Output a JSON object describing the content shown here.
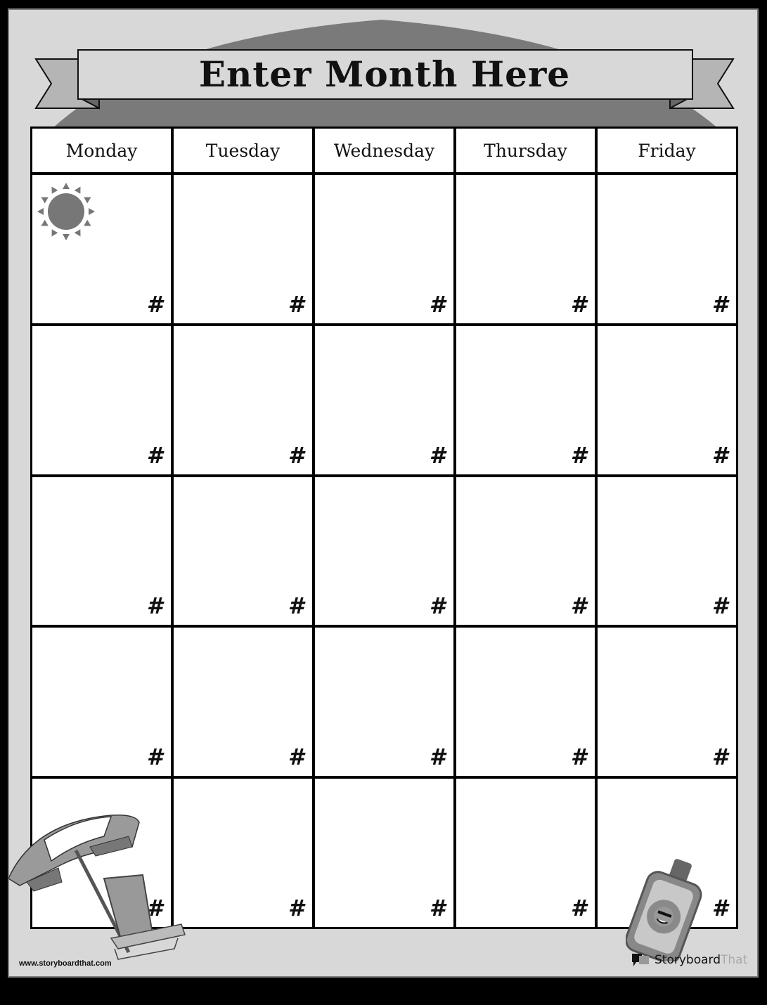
{
  "title": "Enter Month Here",
  "days": [
    "Monday",
    "Tuesday",
    "Wednesday",
    "Thursday",
    "Friday"
  ],
  "weeks": [
    [
      "#",
      "#",
      "#",
      "#",
      "#"
    ],
    [
      "#",
      "#",
      "#",
      "#",
      "#"
    ],
    [
      "#",
      "#",
      "#",
      "#",
      "#"
    ],
    [
      "#",
      "#",
      "#",
      "#",
      "#"
    ],
    [
      "#",
      "#",
      "#",
      "#",
      "#"
    ]
  ],
  "footer": {
    "url": "www.storyboardthat.com",
    "brand_part1": "Storyboard",
    "brand_part2": "That"
  },
  "colors": {
    "page_bg": "#d8d8d8",
    "arch": "#7a7a7a",
    "ribbon_tail": "#b5b5b5",
    "sun": "#777777"
  },
  "icons": [
    "sun-icon",
    "beach-umbrella-icon",
    "beach-chair-icon",
    "sunscreen-bottle-icon",
    "storyboardthat-logo-icon"
  ]
}
